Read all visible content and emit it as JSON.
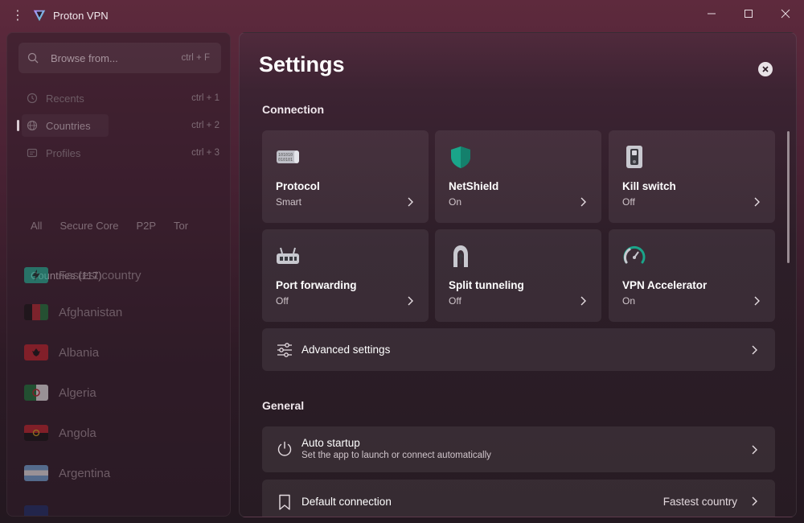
{
  "window": {
    "title": "Proton VPN",
    "controls": [
      "minimize",
      "maximize",
      "close"
    ]
  },
  "sidebar": {
    "search": {
      "placeholder": "Browse from...",
      "shortcut": "ctrl + F"
    },
    "nav": [
      {
        "label": "Recents",
        "shortcut": "ctrl + 1"
      },
      {
        "label": "Countries",
        "shortcut": "ctrl + 2",
        "active": true
      },
      {
        "label": "Profiles",
        "shortcut": "ctrl + 3"
      }
    ],
    "filters": [
      "All",
      "Secure Core",
      "P2P",
      "Tor"
    ],
    "countries_header": "Countries (117)",
    "countries": [
      {
        "label": "Fastest country",
        "flag": "lightning"
      },
      {
        "label": "Afghanistan",
        "flag": "af"
      },
      {
        "label": "Albania",
        "flag": "al"
      },
      {
        "label": "Algeria",
        "flag": "dz"
      },
      {
        "label": "Angola",
        "flag": "ao"
      },
      {
        "label": "Argentina",
        "flag": "ar"
      }
    ]
  },
  "settings": {
    "title": "Settings",
    "connection": {
      "title": "Connection",
      "cards": [
        {
          "title": "Protocol",
          "value": "Smart",
          "icon": "protocol-icon"
        },
        {
          "title": "NetShield",
          "value": "On",
          "icon": "shield-icon"
        },
        {
          "title": "Kill switch",
          "value": "Off",
          "icon": "kill-switch-icon"
        },
        {
          "title": "Port forwarding",
          "value": "Off",
          "icon": "router-icon"
        },
        {
          "title": "Split tunneling",
          "value": "Off",
          "icon": "split-tunnel-icon"
        },
        {
          "title": "VPN Accelerator",
          "value": "On",
          "icon": "gauge-icon"
        }
      ],
      "advanced": "Advanced settings"
    },
    "general": {
      "title": "General",
      "auto_startup": {
        "title": "Auto startup",
        "subtitle": "Set the app to launch or connect automatically"
      },
      "default_connection": {
        "title": "Default connection",
        "value": "Fastest country"
      }
    }
  },
  "colors": {
    "accent_teal": "#1fb89a",
    "panel_bg": "#2d1e28",
    "card_bg": "#3a2b35"
  }
}
